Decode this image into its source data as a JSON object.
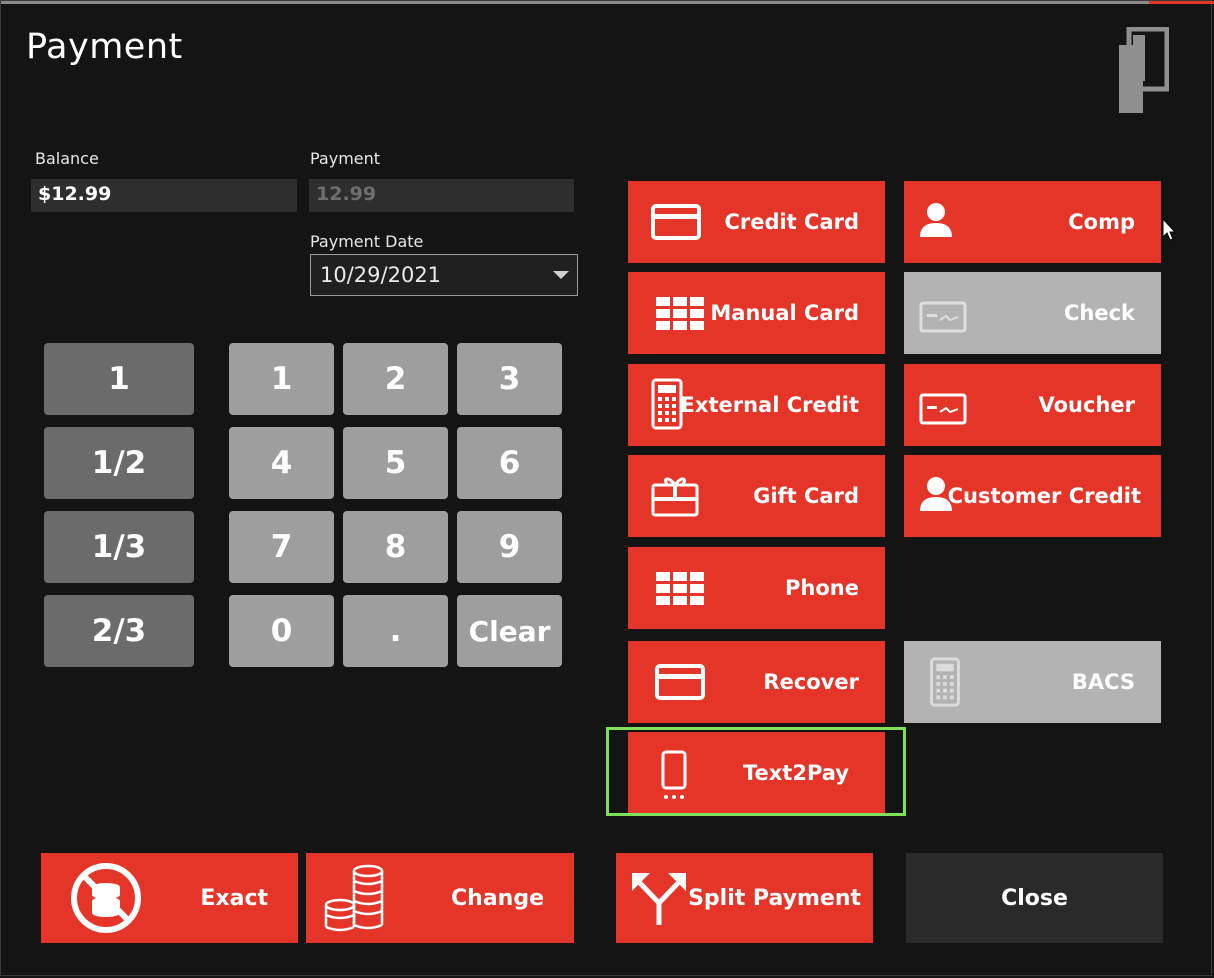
{
  "window": {
    "title": "Payment"
  },
  "balance": {
    "label": "Balance",
    "value": "$12.99"
  },
  "payment": {
    "label": "Payment",
    "value": "12.99"
  },
  "payment_date": {
    "label": "Payment Date",
    "value": "10/29/2021"
  },
  "fraction_keys": [
    "1",
    "1/2",
    "1/3",
    "2/3"
  ],
  "num_keys": [
    "1",
    "2",
    "3",
    "4",
    "5",
    "6",
    "7",
    "8",
    "9",
    "0",
    ".",
    "Clear"
  ],
  "payment_methods": {
    "credit_card": "Credit Card",
    "comp": "Comp",
    "manual_card": "Manual Card",
    "check": "Check",
    "external_credit": "External Credit",
    "voucher": "Voucher",
    "gift_card": "Gift Card",
    "customer_credit": "Customer Credit",
    "phone": "Phone",
    "recover": "Recover",
    "bacs": "BACS",
    "text2pay": "Text2Pay"
  },
  "actions": {
    "exact": "Exact",
    "change": "Change",
    "split_payment": "Split Payment",
    "close": "Close"
  },
  "colors": {
    "accent": "#e53529",
    "disabled": "#b3b3b3",
    "highlight": "#7fe05a",
    "background": "#141414"
  }
}
